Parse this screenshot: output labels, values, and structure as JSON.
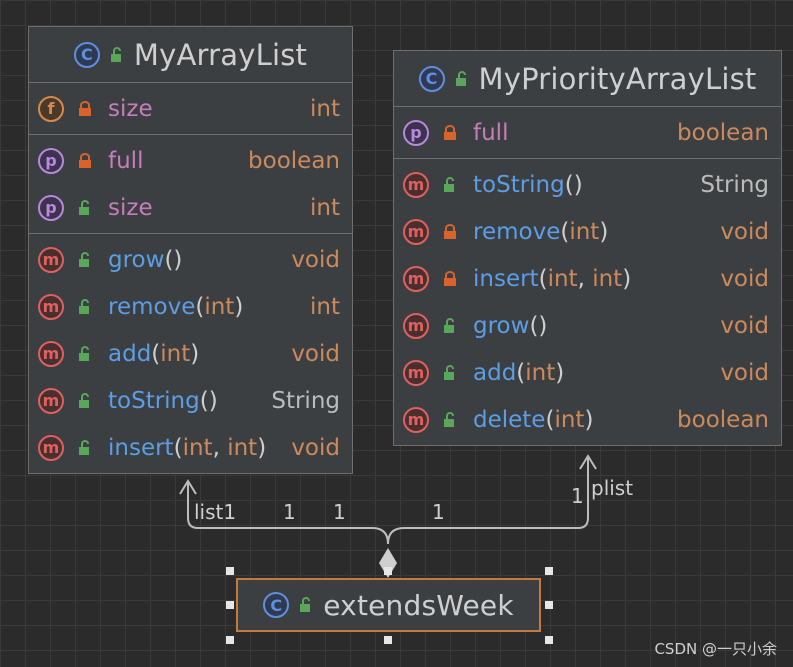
{
  "classes": {
    "my_array_list": {
      "name": "MyArrayList",
      "badge": "C",
      "sections": [
        [
          {
            "kind": "f",
            "visibility": "private",
            "name": "size",
            "type": "int"
          }
        ],
        [
          {
            "kind": "p",
            "visibility": "private",
            "name": "full",
            "type": "boolean"
          },
          {
            "kind": "p",
            "visibility": "public",
            "name": "size",
            "type": "int"
          }
        ],
        [
          {
            "kind": "m",
            "visibility": "public",
            "name": "grow",
            "params": [],
            "type": "void"
          },
          {
            "kind": "m",
            "visibility": "public",
            "name": "remove",
            "params": [
              "int"
            ],
            "type": "int"
          },
          {
            "kind": "m",
            "visibility": "public",
            "name": "add",
            "params": [
              "int"
            ],
            "type": "void"
          },
          {
            "kind": "m",
            "visibility": "public",
            "name": "toString",
            "params": [],
            "type": "String"
          },
          {
            "kind": "m",
            "visibility": "public",
            "name": "insert",
            "params": [
              "int",
              "int"
            ],
            "type": "void"
          }
        ]
      ]
    },
    "my_priority_array_list": {
      "name": "MyPriorityArrayList",
      "badge": "C",
      "sections": [
        [
          {
            "kind": "p",
            "visibility": "private",
            "name": "full",
            "type": "boolean"
          }
        ],
        [
          {
            "kind": "m",
            "visibility": "public",
            "name": "toString",
            "params": [],
            "type": "String"
          },
          {
            "kind": "m",
            "visibility": "private",
            "name": "remove",
            "params": [
              "int"
            ],
            "type": "void"
          },
          {
            "kind": "m",
            "visibility": "private",
            "name": "insert",
            "params": [
              "int",
              "int"
            ],
            "type": "void"
          },
          {
            "kind": "m",
            "visibility": "public",
            "name": "grow",
            "params": [],
            "type": "void"
          },
          {
            "kind": "m",
            "visibility": "public",
            "name": "add",
            "params": [
              "int"
            ],
            "type": "void"
          },
          {
            "kind": "m",
            "visibility": "public",
            "name": "delete",
            "params": [
              "int"
            ],
            "type": "boolean"
          }
        ]
      ]
    },
    "extends_week": {
      "name": "extendsWeek",
      "badge": "C"
    }
  },
  "associations": {
    "list1": {
      "role": "list1",
      "target_multiplicity": "1",
      "source_multiplicity": "1"
    },
    "plist": {
      "role": "plist",
      "target_multiplicity": "1",
      "source_multiplicity": "1"
    },
    "extra_multiplicity": "1"
  },
  "watermark": "CSDN @一只小余",
  "colors": {
    "background": "#2b2b2b",
    "grid": "#3a3a3a",
    "class_fill": "#3c3f41",
    "border": "#6e6e6e",
    "selection": "#c27b3c",
    "method_name": "#5c9ee6",
    "field_name": "#c77dbb",
    "type": "#cc8a5c",
    "lock_private": "#d9632b",
    "lock_public": "#5aa65a",
    "connector": "#bdbdbd"
  },
  "icons": {
    "class_badge": "class-c-icon",
    "method_badge": "method-m-icon",
    "field_badge": "field-f-icon",
    "property_badge": "property-p-icon",
    "private": "lock-closed-icon",
    "public": "lock-open-icon",
    "composition": "diamond-icon"
  }
}
